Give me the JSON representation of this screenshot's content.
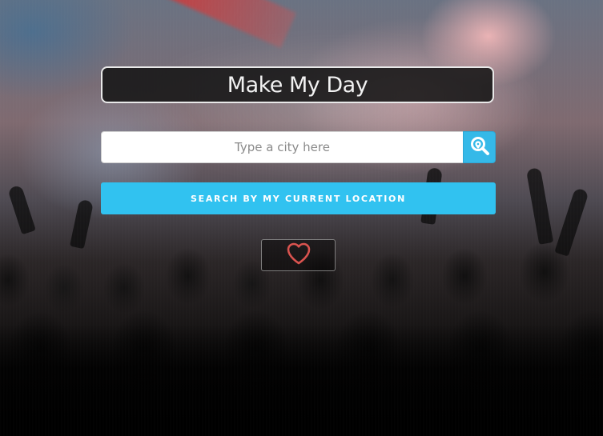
{
  "app": {
    "title": "Make My Day"
  },
  "search": {
    "placeholder": "Type a city here",
    "value": ""
  },
  "buttons": {
    "current_location_label": "SEARCH BY MY CURRENT LOCATION"
  },
  "icons": {
    "search_button_icon": "search-location-icon",
    "favorite_icon": "heart-outline-icon"
  },
  "colors": {
    "accent": "#31c2f0",
    "accent_dark": "#2ea8d6",
    "heart": "#d9534f"
  }
}
